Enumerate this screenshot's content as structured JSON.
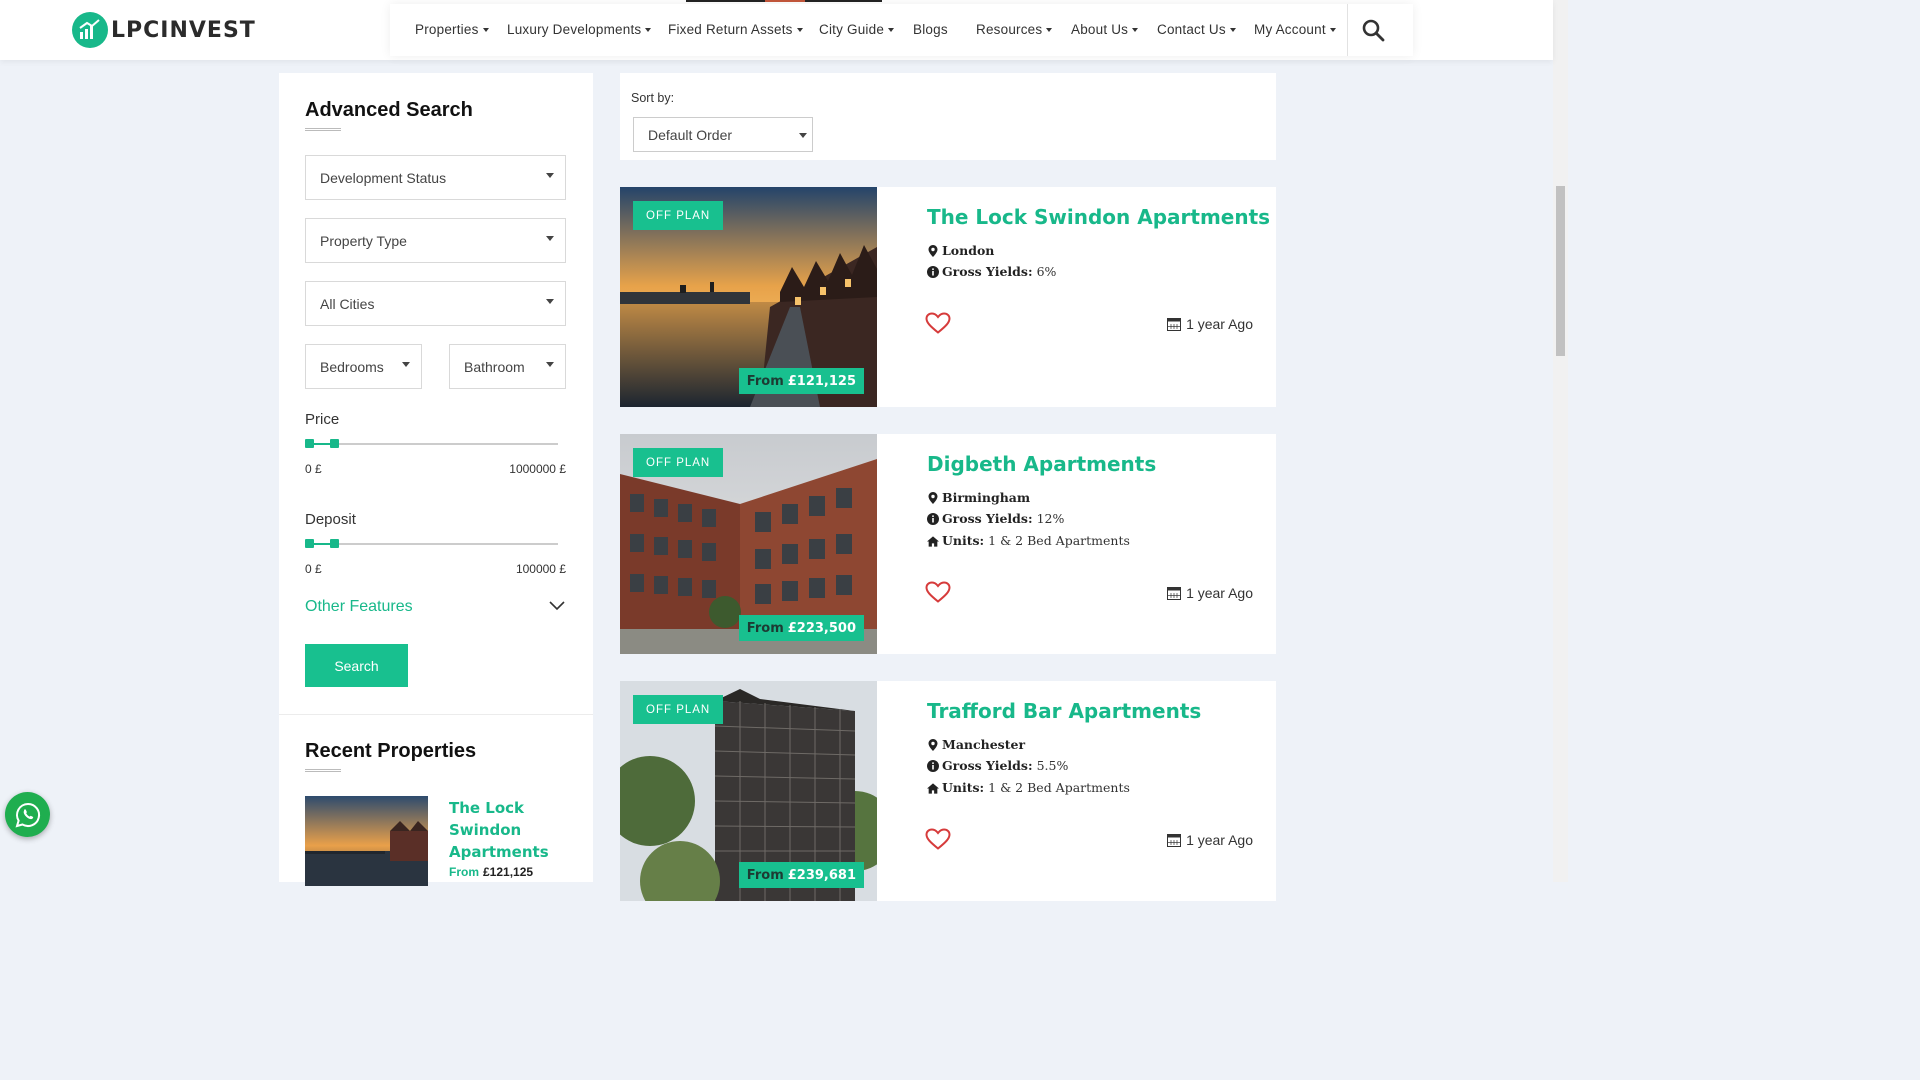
{
  "brand": {
    "name": "LPCINVEST",
    "accent": "#18b88a"
  },
  "nav": {
    "items": [
      {
        "label": "Properties",
        "dropdown": true
      },
      {
        "label": "Luxury Developments",
        "dropdown": true
      },
      {
        "label": "Fixed Return Assets",
        "dropdown": true
      },
      {
        "label": "City Guide",
        "dropdown": true
      },
      {
        "label": "Blogs",
        "dropdown": false
      },
      {
        "label": "Resources",
        "dropdown": true
      },
      {
        "label": "About Us",
        "dropdown": true
      },
      {
        "label": "Contact Us",
        "dropdown": true
      },
      {
        "label": "My Account",
        "dropdown": true
      }
    ],
    "search_icon": "search-icon"
  },
  "sidebar": {
    "title": "Advanced Search",
    "filters": {
      "development_status": "Development Status",
      "property_type": "Property Type",
      "cities": "All Cities",
      "bedrooms": "Bedrooms",
      "bathroom": "Bathroom"
    },
    "price": {
      "label": "Price",
      "min_label": "0 £",
      "max_label": "1000000 £",
      "min": 0,
      "max": 1000000
    },
    "deposit": {
      "label": "Deposit",
      "min_label": "0 £",
      "max_label": "100000 £",
      "min": 0,
      "max": 100000
    },
    "other_features": "Other Features",
    "search_button": "Search",
    "recent_title": "Recent Properties",
    "recent": [
      {
        "name": "The Lock Swindon Apartments",
        "from": "From",
        "price": "£121,125"
      }
    ]
  },
  "sort": {
    "label": "Sort by:",
    "value": "Default Order"
  },
  "listings": [
    {
      "badge": "OFF PLAN",
      "title": "The Lock Swindon Apartments",
      "location": "London",
      "yields_label": "Gross Yields:",
      "yields": "6%",
      "units_label": "",
      "units": "",
      "price_from": "From",
      "price": "£121,125",
      "date": "1 year Ago"
    },
    {
      "badge": "OFF PLAN",
      "title": "Digbeth Apartments",
      "location": "Birmingham",
      "yields_label": "Gross Yields:",
      "yields": "12%",
      "units_label": "Units:",
      "units": "1 & 2 Bed Apartments",
      "price_from": "From",
      "price": "£223,500",
      "date": "1 year Ago"
    },
    {
      "badge": "OFF PLAN",
      "title": "Trafford Bar Apartments",
      "location": "Manchester",
      "yields_label": "Gross Yields:",
      "yields": "5.5%",
      "units_label": "Units:",
      "units": "1 & 2 Bed Apartments",
      "price_from": "From",
      "price": "£239,681",
      "date": "1 year Ago"
    }
  ]
}
